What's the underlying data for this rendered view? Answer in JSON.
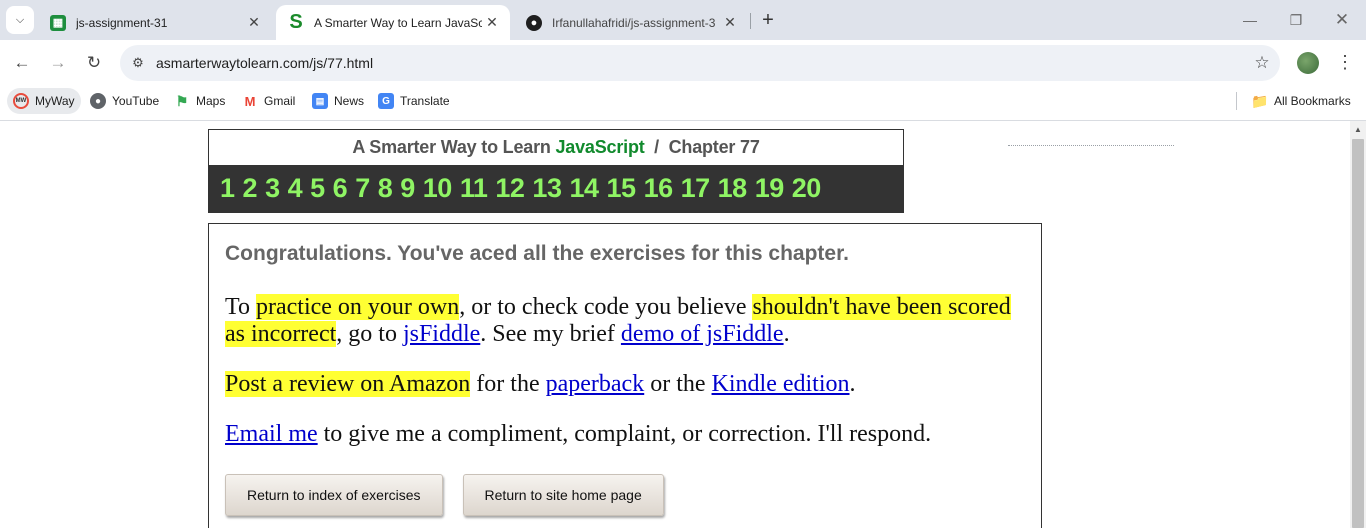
{
  "browser": {
    "tabs": [
      {
        "title": "js-assignment-31",
        "favicon": "sheets-icon",
        "active": false
      },
      {
        "title": "A Smarter Way to Learn JavaScr",
        "favicon": "s-logo-icon",
        "active": true
      },
      {
        "title": "Irfanullahafridi/js-assignment-3",
        "favicon": "github-icon",
        "active": false
      }
    ],
    "url": "asmarterwaytolearn.com/js/77.html",
    "bookmarks": [
      "MyWay",
      "YouTube",
      "Maps",
      "Gmail",
      "News",
      "Translate"
    ],
    "all_bookmarks": "All Bookmarks"
  },
  "page": {
    "header_prefix": "A Smarter Way to Learn",
    "header_js": "JavaScript",
    "header_sep": "/",
    "header_chapter": "Chapter 77",
    "exercise_numbers": [
      "1",
      "2",
      "3",
      "4",
      "5",
      "6",
      "7",
      "8",
      "9",
      "10",
      "11",
      "12",
      "13",
      "14",
      "15",
      "16",
      "17",
      "18",
      "19",
      "20"
    ],
    "congrats": "Congratulations. You've aced all the exercises for this chapter.",
    "p1": {
      "t1": "To ",
      "h1": "practice on your own",
      "t2": ", or to check code you believe ",
      "h2": "shouldn't have been scored as incorrect",
      "t3": ", go to ",
      "l1": "jsFiddle",
      "t4": ". See my brief ",
      "l2": "demo of jsFiddle",
      "t5": "."
    },
    "p2": {
      "h1": "Post a review on Amazon",
      "t1": " for the ",
      "l1": "paperback",
      "t2": " or the ",
      "l2": "Kindle edition",
      "t3": "."
    },
    "p3": {
      "l1": "Email me",
      "t1": " to give me a compliment, complaint, or correction. I'll respond."
    },
    "buttons": {
      "index": "Return to index of exercises",
      "home": "Return to site home page"
    }
  },
  "colors": {
    "highlight": "#ffff33",
    "chapter_numbers": "#8ff464",
    "javascript_word": "#118a2d",
    "chapter_bar": "#333333"
  }
}
